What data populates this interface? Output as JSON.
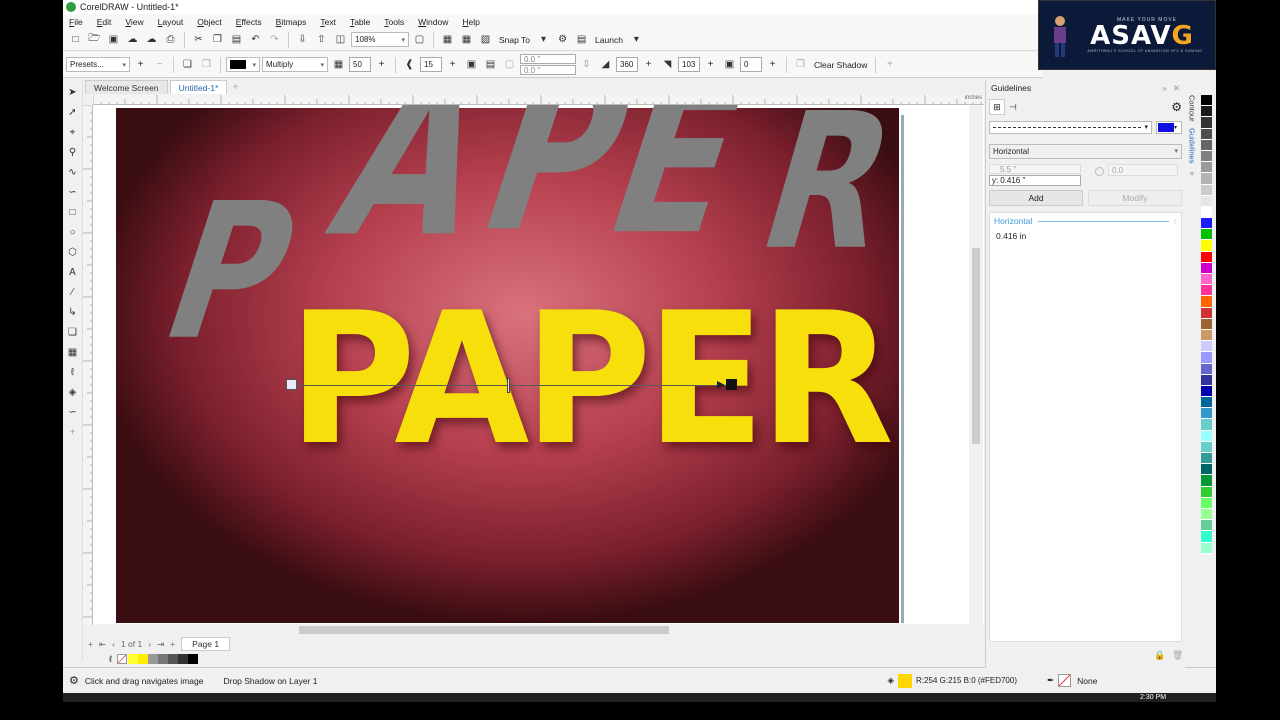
{
  "window": {
    "title": "CorelDRAW - Untitled-1*"
  },
  "menu": [
    "File",
    "Edit",
    "View",
    "Layout",
    "Object",
    "Effects",
    "Bitmaps",
    "Text",
    "Table",
    "Tools",
    "Window",
    "Help"
  ],
  "toolbar1": {
    "zoom": "108%",
    "snap_label": "Snap To",
    "launch_label": "Launch"
  },
  "toolbar2": {
    "presets": "Presets...",
    "blend_mode": "Multiply",
    "opacity": "50",
    "feather": "15",
    "x_offset": "0.0 \"",
    "y_offset": "0.0 \"",
    "angle": "360",
    "stretch": "103",
    "fade": "0",
    "clear_shadow": "Clear Shadow"
  },
  "doc_tabs": [
    "Welcome Screen",
    "Untitled-1*"
  ],
  "artwork": {
    "main_text": "PAPER",
    "shadow_letters": [
      "P",
      "A",
      "P",
      "E",
      "R"
    ]
  },
  "pagenav": {
    "counter": "1 of 1",
    "page_tab": "Page 1"
  },
  "status": {
    "hint": "Click and drag navigates image",
    "selection": "Drop Shadow on Layer 1",
    "fill_color_value": "R:254 G:215 B:0 (#FED700)",
    "fill_color": "#FED700",
    "outline": "None"
  },
  "docker": {
    "title": "Guidelines",
    "orientation": "Horizontal",
    "x_value": "5.5 \"",
    "y_label": "y:",
    "y_value": "0.416 \"",
    "angle_value": "0.0",
    "add_label": "Add",
    "modify_label": "Modify",
    "list_header": "Horizontal",
    "list_item": "0.416 in"
  },
  "side_tabs": [
    "Contour",
    "Guidelines"
  ],
  "ruler_unit": "inches",
  "clock": "2:30 PM",
  "logo": {
    "tagline": "MAKE YOUR MOVE",
    "name_a": "ASAV",
    "name_b": "G",
    "sub": "AMRITHRAJ'S SCHOOL OF ANIMATION VFX & GAMING"
  },
  "colors": {
    "accent": "#2464b0",
    "fill": "#f7df0b",
    "shadow_letters": "#808080"
  },
  "palette": [
    "#000000",
    "#1a1a1a",
    "#333333",
    "#4d4d4d",
    "#666666",
    "#808080",
    "#999999",
    "#b3b3b3",
    "#cccccc",
    "#e6e6e6",
    "#ffffff",
    "#1b1bff",
    "#00c000",
    "#ffff00",
    "#ff0000",
    "#cc00cc",
    "#ff66cc",
    "#ff3399",
    "#ff6600",
    "#cc3333",
    "#996633",
    "#cc9966",
    "#ccccff",
    "#9999ff",
    "#6666cc",
    "#333399",
    "#0000aa",
    "#006699",
    "#3399cc",
    "#66cccc",
    "#99ffff",
    "#66cccc",
    "#339999",
    "#006666",
    "#009933",
    "#33cc33",
    "#66ff66",
    "#99ff99",
    "#66cc99",
    "#33ffcc",
    "#99ffcc"
  ],
  "bottom_swatches": [
    "#ffff33",
    "#ffee00",
    "#999999",
    "#777777",
    "#555555",
    "#333333",
    "#000000"
  ]
}
